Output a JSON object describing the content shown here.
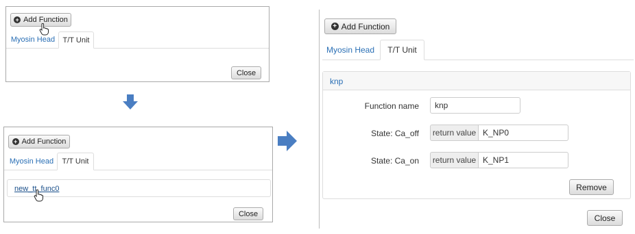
{
  "panel_top_left": {
    "add_button": "Add Function",
    "tabs": [
      {
        "label": "Myosin Head"
      },
      {
        "label": "T/T Unit"
      }
    ],
    "close_button": "Close"
  },
  "panel_bottom_left": {
    "add_button": "Add Function",
    "tabs": [
      {
        "label": "Myosin Head"
      },
      {
        "label": "T/T Unit"
      }
    ],
    "function_link": "new_tt_func0",
    "close_button": "Close"
  },
  "panel_right": {
    "add_button": "Add Function",
    "tabs": [
      {
        "label": "Myosin Head"
      },
      {
        "label": "T/T Unit"
      }
    ],
    "function_heading": "knp",
    "function_name_label": "Function name",
    "function_name_value": "knp",
    "state_rows": [
      {
        "label": "State: Ca_off",
        "addon": "return value",
        "value": "K_NP0"
      },
      {
        "label": "State: Ca_on",
        "addon": "return value",
        "value": "K_NP1"
      }
    ],
    "remove_button": "Remove",
    "close_button": "Close"
  },
  "colors": {
    "arrow": "#4a7ec2",
    "link": "#2a6fb5"
  },
  "icons": {
    "cursor": "hand-pointer-icon",
    "add": "plus-circle-icon",
    "flow_arrow": "arrow-icon"
  }
}
